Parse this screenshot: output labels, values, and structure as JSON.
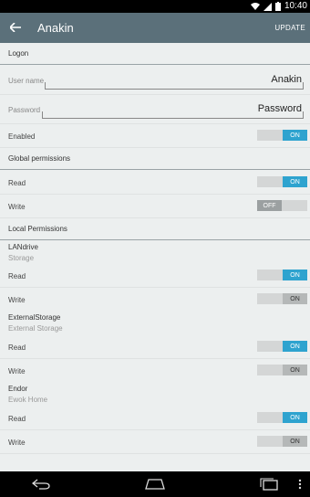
{
  "status_bar": {
    "time": "10:40",
    "icons": [
      "wifi-icon",
      "signal-icon",
      "battery-icon"
    ]
  },
  "app_bar": {
    "title": "Anakin",
    "action": "UPDATE"
  },
  "sections": {
    "logon": "Logon",
    "global": "Global permissions",
    "local": "Local Permissions"
  },
  "logon": {
    "username_label": "User name",
    "username_value": "Anakin",
    "password_label": "Password",
    "password_value": "Password",
    "enabled_label": "Enabled",
    "enabled_toggle": "ON"
  },
  "global": {
    "read_label": "Read",
    "read_toggle": "ON",
    "write_label": "Write",
    "write_toggle": "OFF"
  },
  "shares": [
    {
      "name": "LANdrive",
      "description": "Storage",
      "read_label": "Read",
      "read_toggle": "ON",
      "write_label": "Write",
      "write_toggle": "ON"
    },
    {
      "name": "ExternalStorage",
      "description": "External Storage",
      "read_label": "Read",
      "read_toggle": "ON",
      "write_label": "Write",
      "write_toggle": "ON"
    },
    {
      "name": "Endor",
      "description": "Ewok Home",
      "read_label": "Read",
      "read_toggle": "ON",
      "write_label": "Write",
      "write_toggle": "ON"
    }
  ],
  "colors": {
    "app_bar": "#5b707a",
    "toggle_on": "#2ea3cf",
    "background": "#ecefef"
  }
}
